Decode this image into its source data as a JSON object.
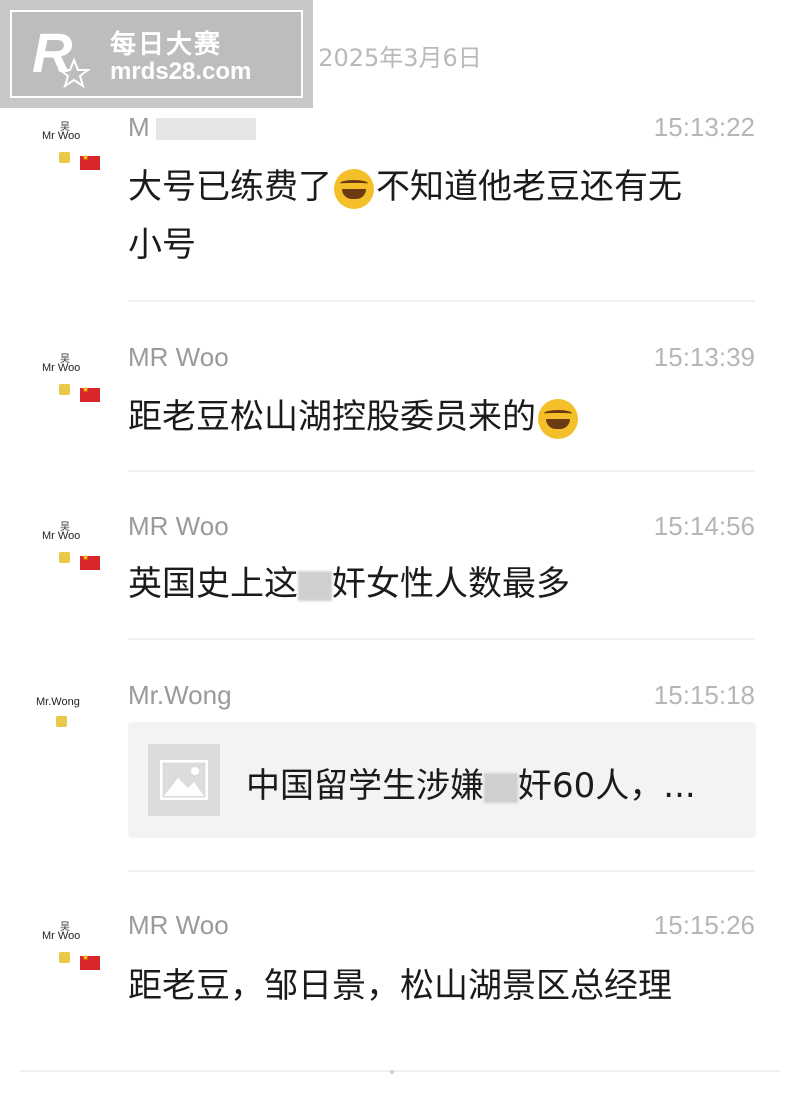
{
  "watermark": {
    "line1": "每日大赛",
    "line2": "mrds28.com",
    "logo_letter": "R"
  },
  "date_separator": "2025年3月6日",
  "messages": [
    {
      "avatar_top": "吴",
      "avatar_name": "Mr Woo",
      "sender": "M",
      "time": "15:13:22",
      "text_a": "大号已练费了",
      "text_b": "不知道他老豆还有无",
      "text_c": "小号"
    },
    {
      "avatar_top": "吴",
      "avatar_name": "Mr Woo",
      "sender": "MR Woo",
      "time": "15:13:39",
      "text_a": "距老豆松山湖控股委员来的"
    },
    {
      "avatar_top": "吴",
      "avatar_name": "Mr Woo",
      "sender": "MR Woo",
      "time": "15:14:56",
      "text_a": "英国史上这",
      "text_b": "奸女性人数最多"
    },
    {
      "avatar_name": "Mr.Wong",
      "sender": "Mr.Wong",
      "time": "15:15:18",
      "card_a": "中国留学生涉嫌",
      "card_b": "奸60人，..."
    },
    {
      "avatar_top": "吴",
      "avatar_name": "Mr Woo",
      "sender": "MR Woo",
      "time": "15:15:26",
      "text_a": "距老豆，邹日景，松山湖景区总经理"
    }
  ],
  "colors": {
    "flag_red": "#d8262b",
    "badge_yellow": "#e8c94a",
    "emoji_yellow": "#f5bf2a"
  },
  "icons": [
    "laughing-emoji",
    "image-placeholder-icon",
    "china-flag-icon"
  ]
}
